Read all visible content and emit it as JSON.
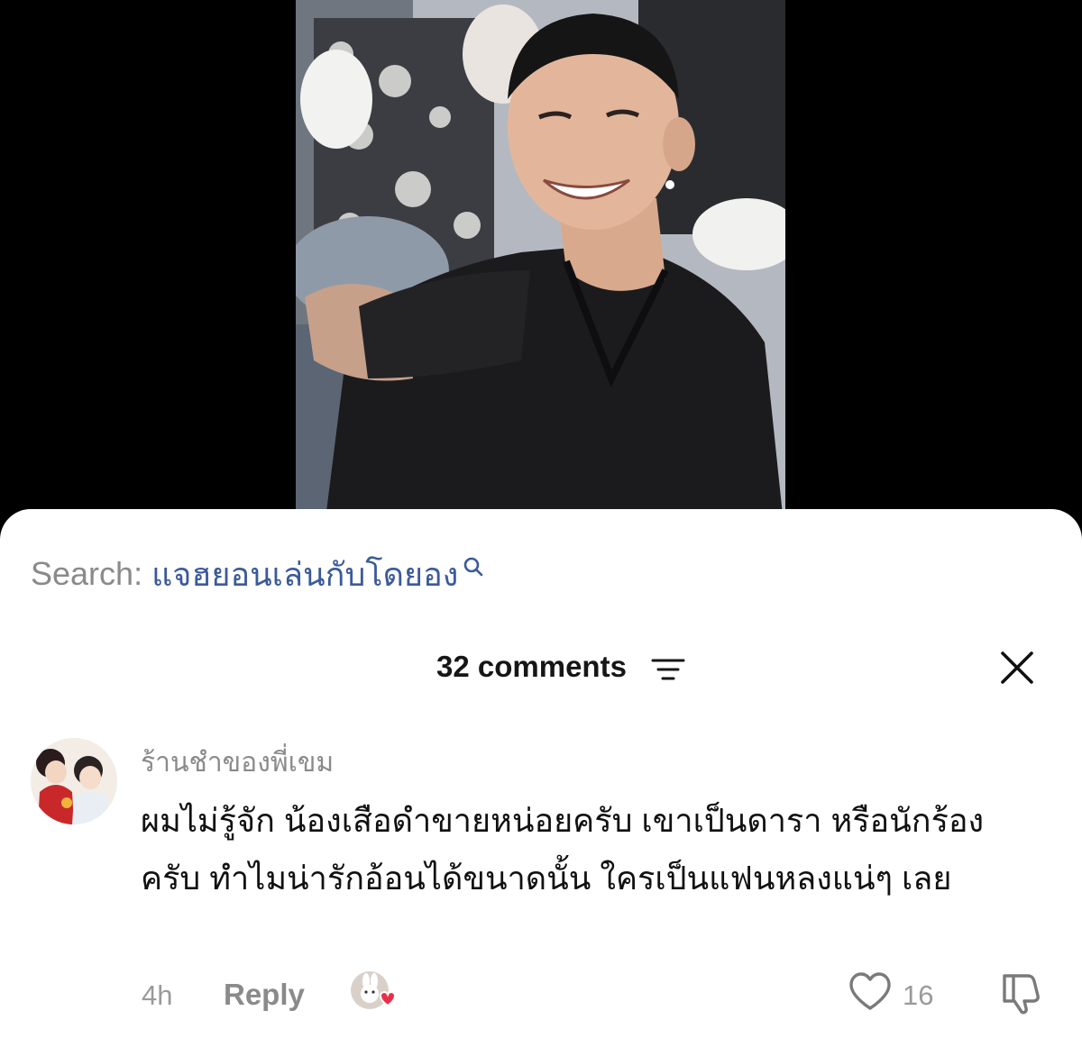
{
  "video": {
    "image": "smiling-man-black-shirt"
  },
  "search": {
    "label": "Search:",
    "query": "แจฮยอนเล่นกับโดยอง",
    "icon": "search-icon"
  },
  "comments_header": {
    "count_label": "32 comments",
    "filter_icon": "filter-icon",
    "close_icon": "close-icon"
  },
  "comment": {
    "username": "ร้านชำของพี่เขม",
    "text": "ผมไม่รู้จัก น้องเสือดำขายหน่อยครับ เขาเป็นดารา หรือนักร้องครับ ทำไมน่ารักอ้อนได้ขนาดนั้น ใครเป็นแฟนหลงแน่ๆ เลย",
    "time": "4h",
    "reply_label": "Reply",
    "like_count": "16"
  },
  "colors": {
    "search_query": "#3b5a9a",
    "muted": "#8a8a8a",
    "heart_badge": "#e8304a"
  }
}
